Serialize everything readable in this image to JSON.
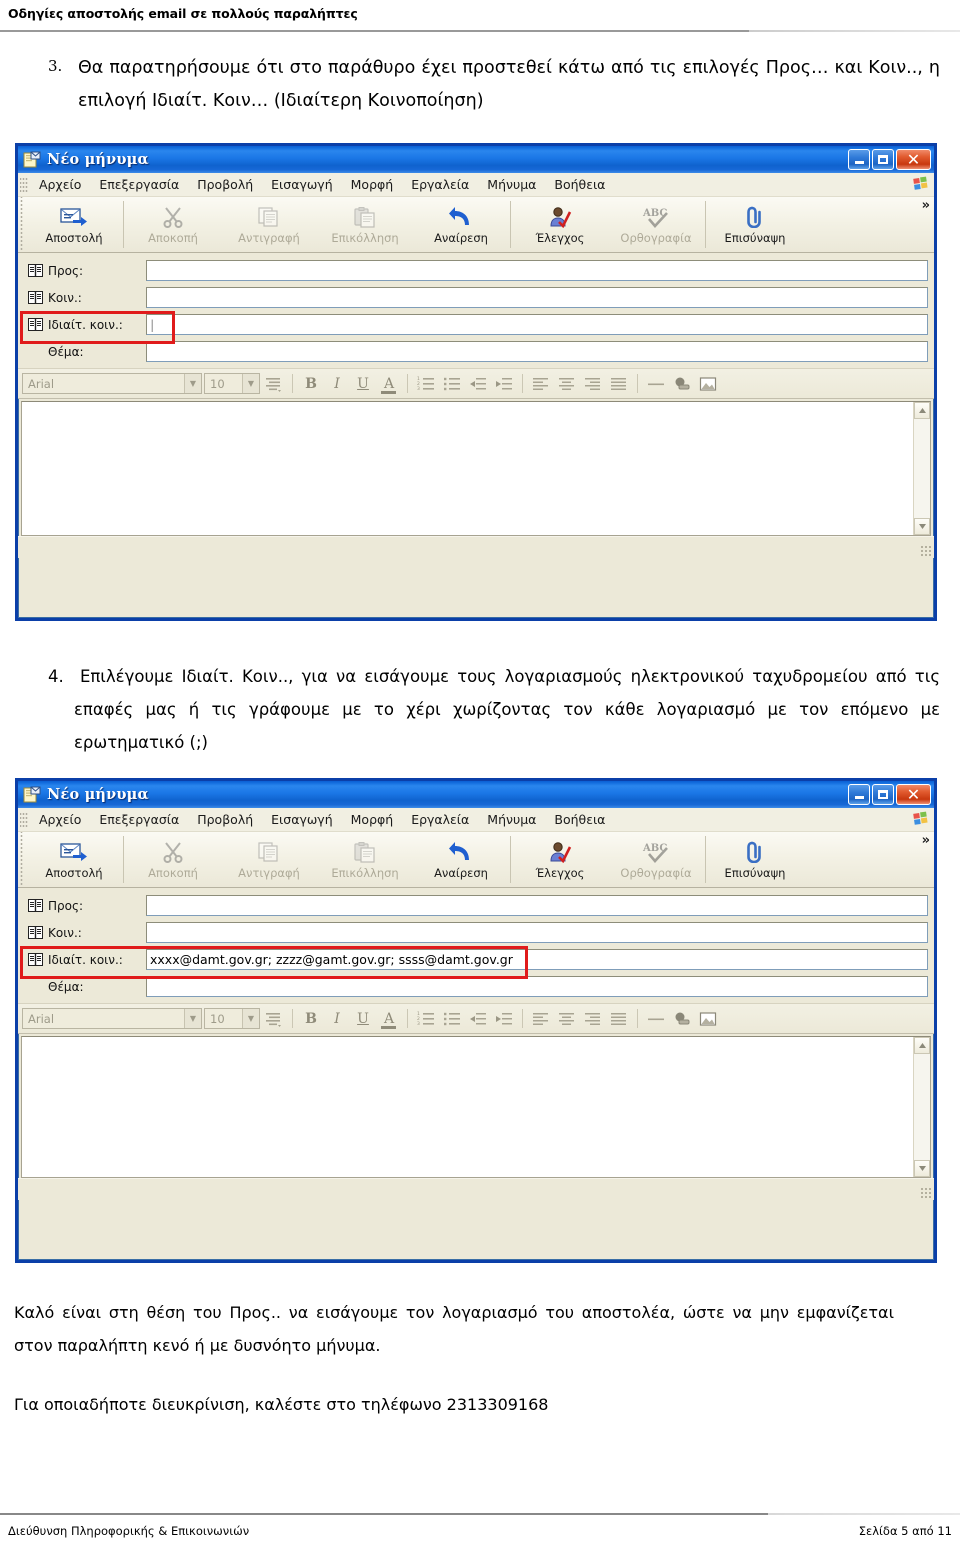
{
  "document": {
    "header": "Οδηγίες αποστολής email σε πολλούς παραλήπτες",
    "footer_left": "Διεύθυνση Πληροφορικής & Επικοινωνιών",
    "footer_right": "Σελίδα 5 από 11"
  },
  "paragraphs": {
    "item3_number": "3.",
    "item3_text": "Θα παρατηρήσουμε ότι στο παράθυρο έχει προστεθεί κάτω από τις επιλογές Προς… και Κοιν.., η επιλογή Ιδιαίτ. Κοιν… (Ιδιαίτερη Κοινοποίηση)",
    "item4_number": "4.",
    "item4_text": "Επιλέγουμε Ιδιαίτ. Κοιν.., για να εισάγουμε τους λογαριασμούς ηλεκτρονικού ταχυδρομείου από τις επαφές μας ή τις γράφουμε με το χέρι χωρίζοντας τον κάθε λογαριασμό με τον επόμενο με ερωτηματικό (;)",
    "closing1": "Καλό είναι στη θέση του Προς.. να εισάγουμε τον λογαριασμό του αποστολέα, ώστε να μην εμφανίζεται στον παραλήπτη κενό ή με δυσνόητο μήνυμα.",
    "closing2": "Για οποιαδήποτε διευκρίνιση, καλέστε στο τηλέφωνο 2313309168"
  },
  "mail_window": {
    "title": "Νέο μήνυμα",
    "title_icon": "new-message-icon",
    "caption_buttons": {
      "minimize": "minimize-icon",
      "maximize": "maximize-icon",
      "close": "✕"
    },
    "menu": [
      "Αρχείο",
      "Επεξεργασία",
      "Προβολή",
      "Εισαγωγή",
      "Μορφή",
      "Εργαλεία",
      "Μήνυμα",
      "Βοήθεια"
    ],
    "toolbar": [
      {
        "label": "Αποστολή",
        "icon": "send-icon",
        "disabled": false
      },
      {
        "label": "Αποκοπή",
        "icon": "scissors-icon",
        "disabled": true
      },
      {
        "label": "Αντιγραφή",
        "icon": "copy-icon",
        "disabled": true
      },
      {
        "label": "Επικόλληση",
        "icon": "paste-icon",
        "disabled": true
      },
      {
        "label": "Αναίρεση",
        "icon": "undo-arrow-icon",
        "disabled": false
      },
      {
        "label": "Έλεγχος",
        "icon": "check-names-icon",
        "disabled": false
      },
      {
        "label": "Ορθογραφία",
        "icon": "abc-spell-icon",
        "disabled": true
      },
      {
        "label": "Επισύναψη",
        "icon": "paperclip-icon",
        "disabled": false
      }
    ],
    "toolbar_overflow": "»",
    "address_fields": {
      "to_label": "Προς:",
      "cc_label": "Κοιν.:",
      "bcc_label": "Ιδιαίτ. κοιν.:",
      "subject_label": "Θέμα:",
      "book_icon": "address-book-icon"
    },
    "format_bar": {
      "font_value": "Arial",
      "size_value": "10",
      "icons": [
        "paragraph-style-icon",
        "bold-icon",
        "italic-icon",
        "underline-icon",
        "font-color-icon",
        "numbered-list-icon",
        "bulleted-list-icon",
        "decrease-indent-icon",
        "increase-indent-icon",
        "align-left-icon",
        "align-center-icon",
        "align-right-icon",
        "justify-icon",
        "horizontal-rule-icon",
        "hyperlink-icon",
        "insert-picture-icon"
      ],
      "labels": {
        "bold": "B",
        "italic": "I",
        "underline": "U",
        "font_color": "A"
      }
    },
    "scrollbar": {
      "up": "▲",
      "down": "▼"
    }
  },
  "window_one": {
    "to_value": "",
    "cc_value": "",
    "bcc_value": "",
    "subject_value": "",
    "bcc_caret": "|"
  },
  "window_two": {
    "to_value": "",
    "cc_value": "",
    "bcc_value": "xxxx@damt.gov.gr; zzzz@gamt.gov.gr; ssss@damt.gov.gr",
    "subject_value": ""
  },
  "colors": {
    "titlebar_blue": "#1768d6",
    "window_border": "#0b3fa8",
    "chrome": "#ece9d8",
    "highlight_red": "#e01b1b",
    "close_red": "#c8380f"
  }
}
